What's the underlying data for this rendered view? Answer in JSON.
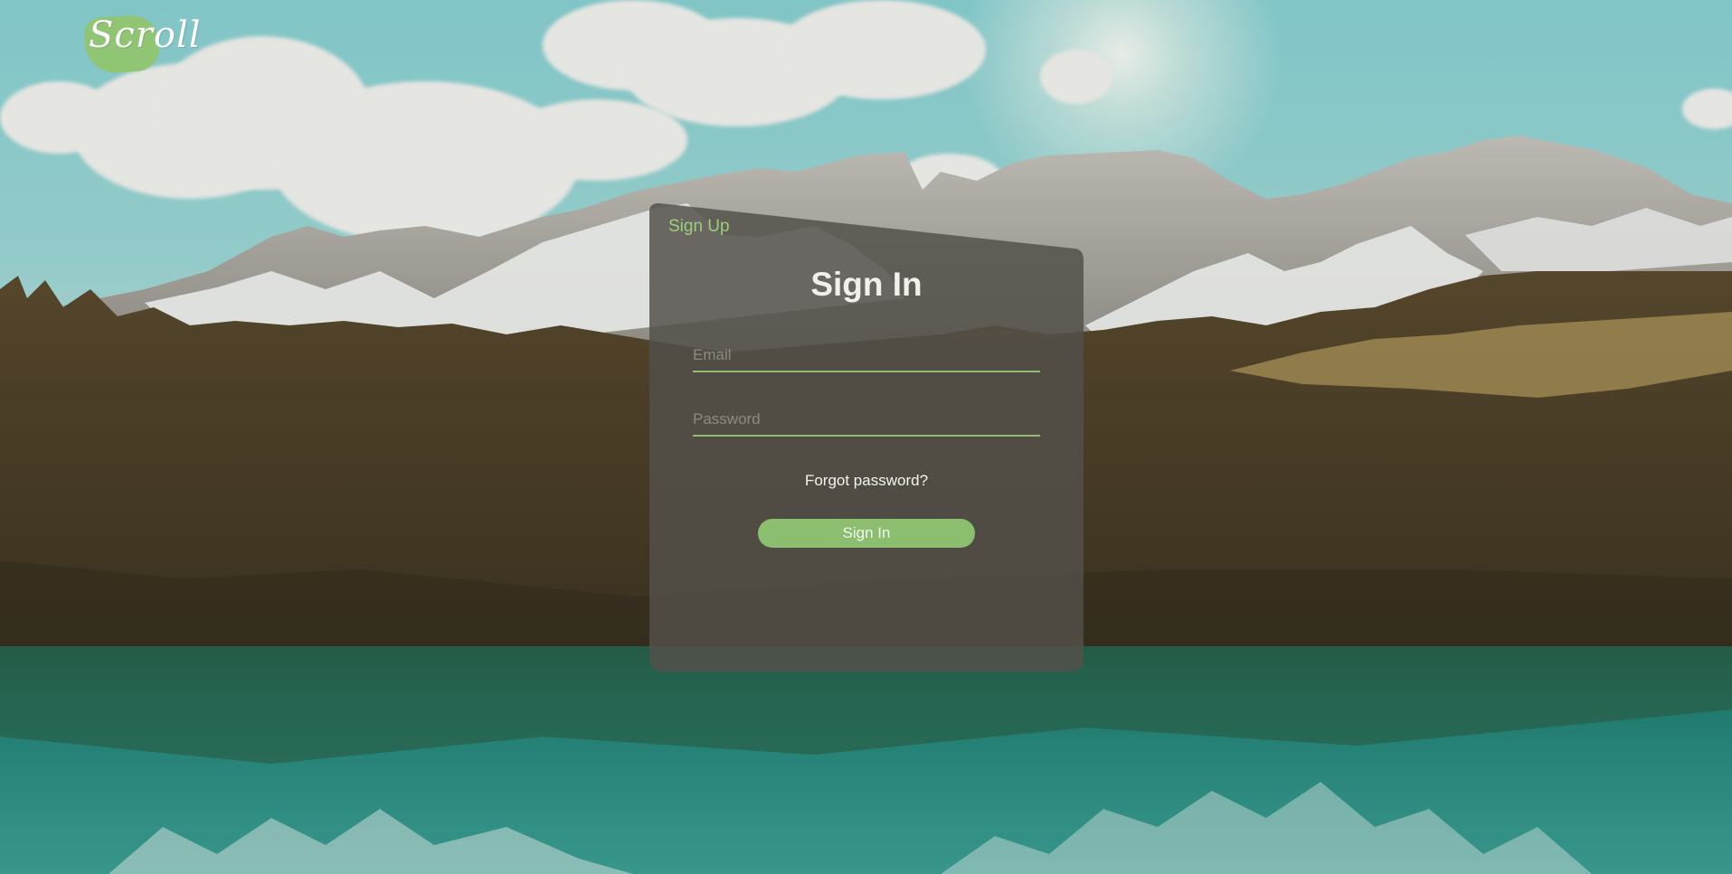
{
  "logo": {
    "text": "Scroll",
    "accent_color": "#8fc56f"
  },
  "auth": {
    "signup_tab": "Sign Up",
    "title": "Sign In",
    "email_placeholder": "Email",
    "password_placeholder": "Password",
    "forgot_link": "Forgot password?",
    "submit_label": "Sign In"
  },
  "colors": {
    "accent": "#8bbf6f",
    "card": "#54504a",
    "text": "#f1f1ec"
  }
}
